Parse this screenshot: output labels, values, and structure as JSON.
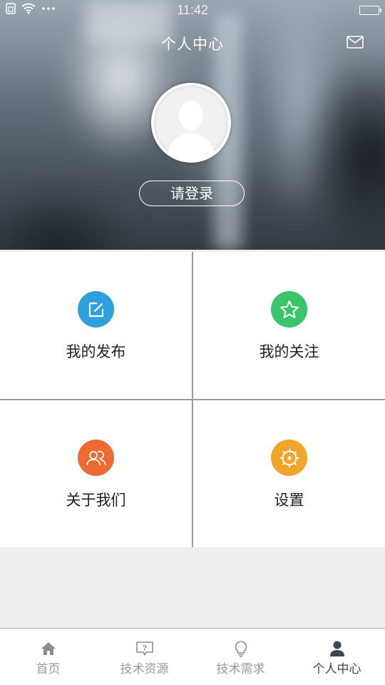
{
  "status_bar": {
    "time": "11:42",
    "icons": [
      "sim-icon",
      "wifi-icon",
      "more-dots-icon",
      "battery-icon"
    ]
  },
  "header": {
    "title": "个人中心",
    "mail_icon": "mail-icon",
    "login_label": "请登录"
  },
  "grid": {
    "items": [
      {
        "label": "我的发布",
        "icon": "edit-icon",
        "color": "#2ea1dc"
      },
      {
        "label": "我的关注",
        "icon": "star-icon",
        "color": "#3ac569"
      },
      {
        "label": "关于我们",
        "icon": "people-icon",
        "color": "#ef6a30"
      },
      {
        "label": "设置",
        "icon": "settings-icon",
        "color": "#f0a42a"
      }
    ]
  },
  "bottom_nav": {
    "items": [
      {
        "label": "首页",
        "icon": "home-icon",
        "active": false
      },
      {
        "label": "技术资源",
        "icon": "question-icon",
        "active": false
      },
      {
        "label": "技术需求",
        "icon": "bulb-icon",
        "active": false
      },
      {
        "label": "个人中心",
        "icon": "user-icon",
        "active": true
      }
    ],
    "active_color": "#3c4754",
    "inactive_color": "#9a9a9a"
  }
}
